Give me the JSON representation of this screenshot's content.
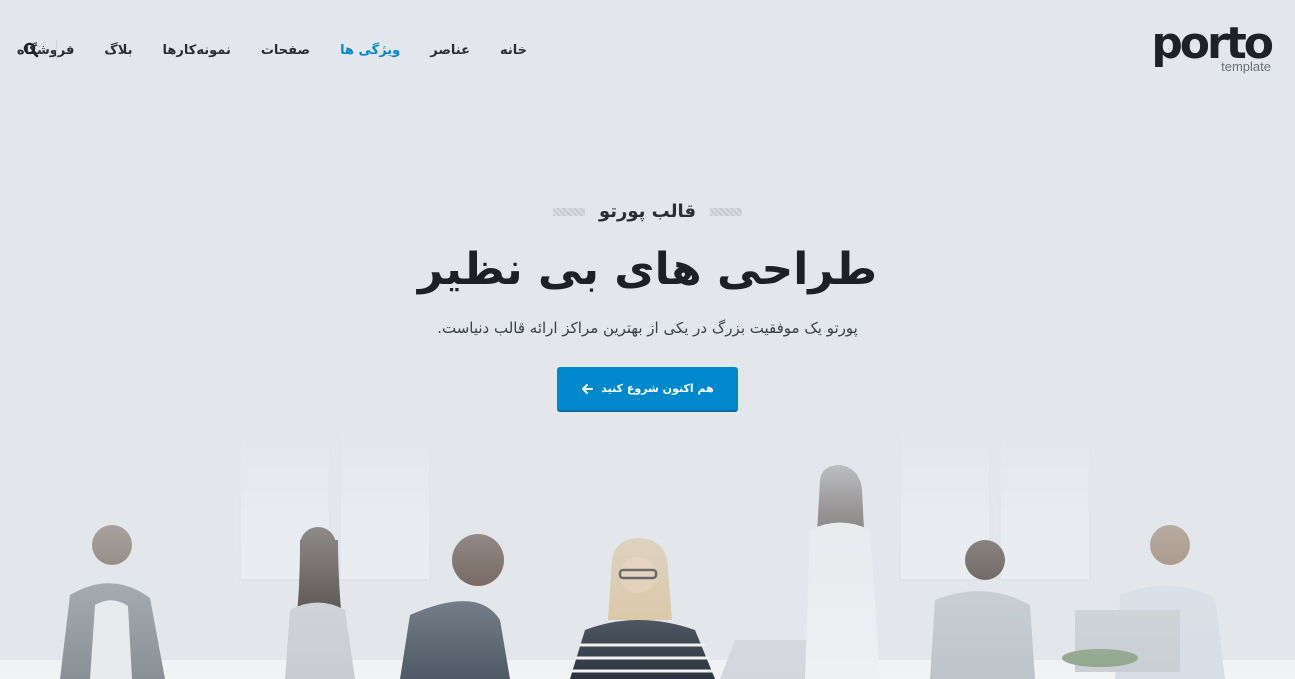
{
  "header": {
    "logo": {
      "word": "porto",
      "sub": "template"
    },
    "nav": [
      {
        "label": "خانه",
        "active": false
      },
      {
        "label": "عناصر",
        "active": false
      },
      {
        "label": "ویژگی ها",
        "active": true
      },
      {
        "label": "صفحات",
        "active": false
      },
      {
        "label": "نمونه‌کارها",
        "active": false
      },
      {
        "label": "بلاگ",
        "active": false
      },
      {
        "label": "فروشگاه",
        "active": false
      }
    ],
    "search_icon": "search-icon"
  },
  "hero": {
    "eyebrow": "قالب پورتو",
    "title": "طراحی های بی نظیر",
    "subtitle": "پورتو یک موفقیت بزرگ در یکی از بهترین مراکز ارائه قالب دنیاست.",
    "cta_label": "هم اکنون شروع کنید",
    "cta_icon": "arrow-left-icon"
  },
  "colors": {
    "accent": "#0088cc",
    "background": "#e3e7ec",
    "text": "#1d2125"
  },
  "background_image": "office-team-photo"
}
